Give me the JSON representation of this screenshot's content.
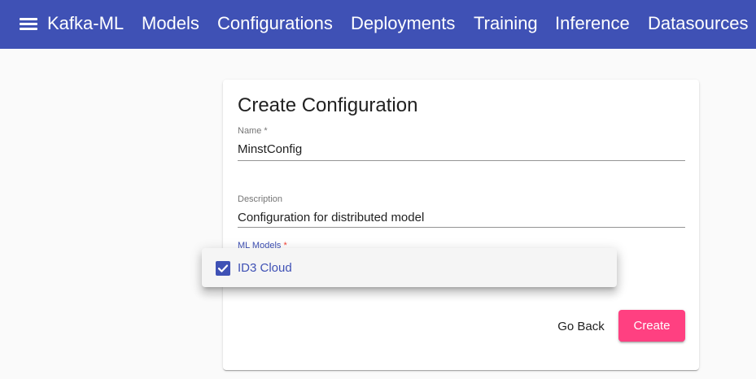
{
  "toolbar": {
    "brand": "Kafka-ML",
    "nav": [
      "Models",
      "Configurations",
      "Deployments",
      "Training",
      "Inference",
      "Datasources"
    ]
  },
  "form": {
    "title": "Create Configuration",
    "name_label": "Name *",
    "name_value": "MinstConfig",
    "description_label": "Description",
    "description_value": "Configuration for distributed model",
    "ml_models_label": "ML Models",
    "ml_models_required": "*",
    "go_back_label": "Go Back",
    "create_label": "Create"
  },
  "dropdown": {
    "options": [
      {
        "label": "ID3 Cloud",
        "checked": true
      }
    ]
  },
  "colors": {
    "primary": "#3f51b5",
    "accent": "#ff4081"
  },
  "icons": {
    "menu": "menu-icon",
    "checkbox": "check-icon"
  }
}
